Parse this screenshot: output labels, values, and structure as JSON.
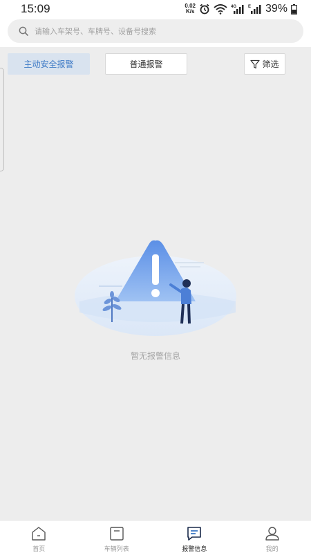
{
  "status_bar": {
    "time": "15:09",
    "net_speed_value": "0.02",
    "net_speed_unit": "K/s",
    "battery": "39%",
    "icons": [
      "alarm-icon",
      "wifi-icon",
      "signal-4g-icon",
      "signal-e-icon",
      "battery-icon"
    ]
  },
  "search": {
    "placeholder": "请输入车架号、车牌号、设备号搜索"
  },
  "tabs": {
    "active_label": "主动安全报警",
    "normal_label": "普通报警",
    "filter_label": "筛选"
  },
  "empty_state": {
    "message": "暂无报警信息"
  },
  "bottom_nav": {
    "items": [
      {
        "label": "首页",
        "icon": "home-icon"
      },
      {
        "label": "车辆列表",
        "icon": "vehicle-list-icon"
      },
      {
        "label": "报警信息",
        "icon": "alarm-message-icon"
      },
      {
        "label": "我的",
        "icon": "profile-icon"
      }
    ],
    "active_index": 2
  },
  "colors": {
    "accent": "#3c79c5",
    "active_tab_bg": "#d9e3ef",
    "page_bg": "#ededed"
  }
}
